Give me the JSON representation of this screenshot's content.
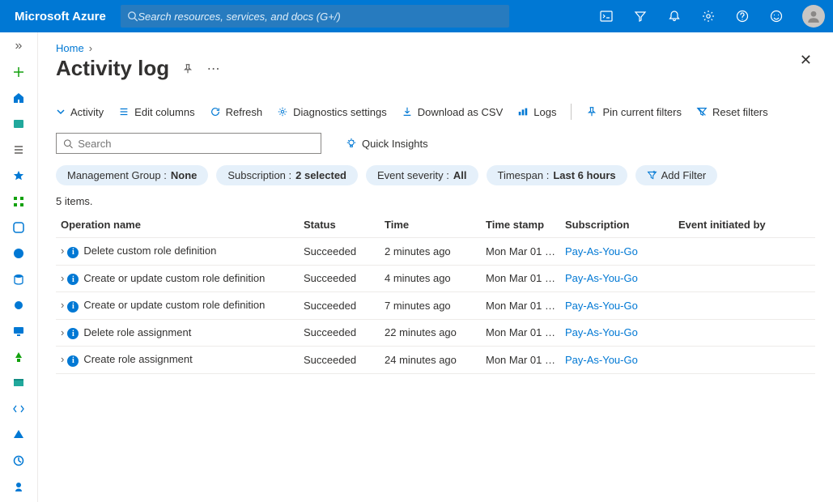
{
  "brand": "Microsoft Azure",
  "search_placeholder": "Search resources, services, and docs (G+/)",
  "breadcrumb": {
    "home": "Home"
  },
  "title": "Activity log",
  "toolbar": {
    "activity": "Activity",
    "edit_columns": "Edit columns",
    "refresh": "Refresh",
    "diag": "Diagnostics settings",
    "download": "Download as CSV",
    "logs": "Logs",
    "pin": "Pin current filters",
    "reset": "Reset filters"
  },
  "local_search_placeholder": "Search",
  "quick_insights": "Quick Insights",
  "filters": {
    "mg_label": "Management Group : ",
    "mg_value": "None",
    "sub_label": "Subscription : ",
    "sub_value": "2 selected",
    "sev_label": "Event severity : ",
    "sev_value": "All",
    "ts_label": "Timespan : ",
    "ts_value": "Last 6 hours",
    "add": "Add Filter"
  },
  "count": "5 items.",
  "columns": {
    "op": "Operation name",
    "status": "Status",
    "time": "Time",
    "timestamp": "Time stamp",
    "sub": "Subscription",
    "initiator": "Event initiated by"
  },
  "rows": [
    {
      "op": "Delete custom role definition",
      "status": "Succeeded",
      "time": "2 minutes ago",
      "ts": "Mon Mar 01 …",
      "sub": "Pay-As-You-Go",
      "initiator": ""
    },
    {
      "op": "Create or update custom role definition",
      "status": "Succeeded",
      "time": "4 minutes ago",
      "ts": "Mon Mar 01 …",
      "sub": "Pay-As-You-Go",
      "initiator": ""
    },
    {
      "op": "Create or update custom role definition",
      "status": "Succeeded",
      "time": "7 minutes ago",
      "ts": "Mon Mar 01 …",
      "sub": "Pay-As-You-Go",
      "initiator": ""
    },
    {
      "op": "Delete role assignment",
      "status": "Succeeded",
      "time": "22 minutes ago",
      "ts": "Mon Mar 01 …",
      "sub": "Pay-As-You-Go",
      "initiator": ""
    },
    {
      "op": "Create role assignment",
      "status": "Succeeded",
      "time": "24 minutes ago",
      "ts": "Mon Mar 01 …",
      "sub": "Pay-As-You-Go",
      "initiator": ""
    }
  ]
}
